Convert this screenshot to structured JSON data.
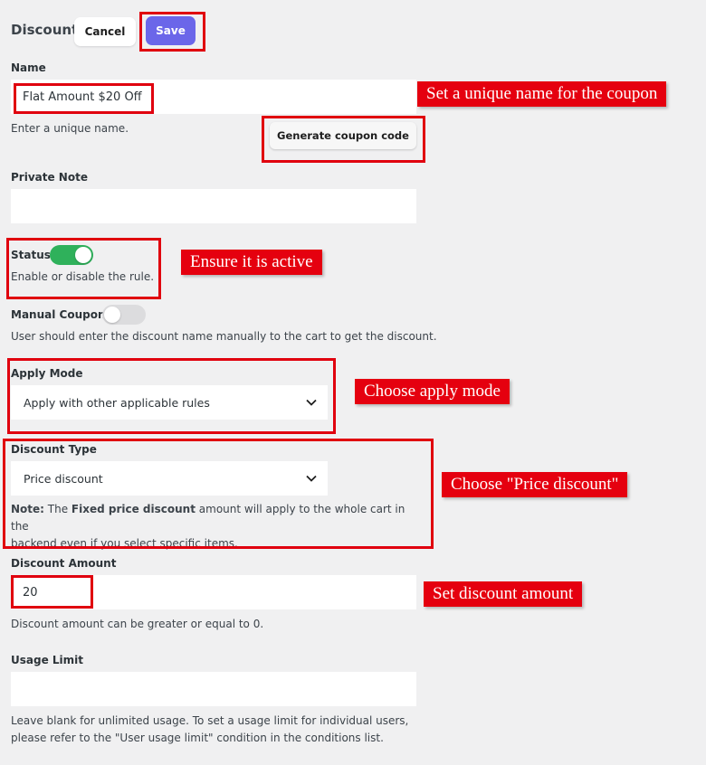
{
  "header": {
    "title": "Discount",
    "cancel_label": "Cancel",
    "save_label": "Save"
  },
  "name_field": {
    "label": "Name",
    "value": "Flat Amount $20 Off",
    "help": "Enter a unique name.",
    "generate_label": "Generate coupon code"
  },
  "private_note": {
    "label": "Private Note",
    "value": ""
  },
  "status": {
    "label": "Status",
    "enabled": true,
    "help": "Enable or disable the rule."
  },
  "manual_coupon": {
    "label": "Manual Coupon",
    "enabled": false,
    "help": "User should enter the discount name manually to the cart to get the discount."
  },
  "apply_mode": {
    "label": "Apply Mode",
    "selected": "Apply with other applicable rules"
  },
  "discount_type": {
    "label": "Discount Type",
    "selected": "Price discount",
    "note_prefix": "Note:",
    "note_text_1": " The ",
    "note_bold": "Fixed price discount",
    "note_text_2": " amount will apply to the whole cart in the",
    "note_line2": "backend even if you select specific items."
  },
  "discount_amount": {
    "label": "Discount Amount",
    "value": "20",
    "help": "Discount amount can be greater or equal to 0."
  },
  "usage_limit": {
    "label": "Usage Limit",
    "value": "",
    "help_line1": "Leave blank for unlimited usage. To set a usage limit for individual users,",
    "help_line2": "please refer to the \"User usage limit\" condition in the conditions list."
  },
  "annotations": {
    "name": "Set a unique name for the coupon",
    "status": "Ensure it is active",
    "apply_mode": "Choose apply mode",
    "discount_type": "Choose \"Price discount\"",
    "amount": "Set discount amount"
  },
  "colors": {
    "accent": "#6b66e9",
    "toggle_on": "#2fb15b",
    "annotation_red": "#e5000f"
  },
  "icons": {
    "select_arrow": "chevron-down-icon"
  }
}
